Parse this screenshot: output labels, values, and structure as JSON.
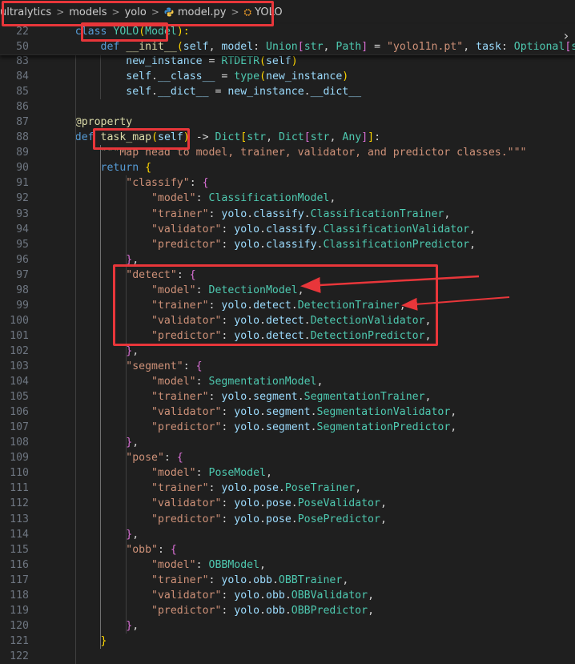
{
  "breadcrumb": {
    "items": [
      "ultralytics",
      "models",
      "yolo",
      "model.py",
      "YOLO"
    ],
    "separator": ">",
    "icons": [
      "python-file-icon",
      "class-symbol-icon"
    ]
  },
  "sticky_lines": [
    {
      "n": "22",
      "tokens": [
        [
          "    ",
          ""
        ],
        [
          "class",
          "kw"
        ],
        [
          " ",
          ""
        ],
        [
          "YOLO",
          "cls"
        ],
        [
          "(",
          "br1"
        ],
        [
          "Model",
          "cls"
        ],
        [
          "):",
          "br1"
        ]
      ]
    },
    {
      "n": "50",
      "tokens": [
        [
          "        ",
          ""
        ],
        [
          "def",
          "kw"
        ],
        [
          " ",
          ""
        ],
        [
          "__init__",
          "fn"
        ],
        [
          "(",
          "br1"
        ],
        [
          "self",
          "sf"
        ],
        [
          ", ",
          ""
        ],
        [
          "model",
          "var"
        ],
        [
          ": ",
          ""
        ],
        [
          "Union",
          "cls"
        ],
        [
          "[",
          "br2"
        ],
        [
          "str",
          "cls"
        ],
        [
          ", ",
          ""
        ],
        [
          "Path",
          "cls"
        ],
        [
          "]",
          "br2"
        ],
        [
          " = ",
          ""
        ],
        [
          "\"yolo11n.pt\"",
          "str"
        ],
        [
          ", ",
          ""
        ],
        [
          "task",
          "var"
        ],
        [
          ": ",
          ""
        ],
        [
          "Optional",
          "cls"
        ],
        [
          "[",
          "br2"
        ],
        [
          "str",
          "cls"
        ],
        [
          "]",
          "br2"
        ]
      ]
    }
  ],
  "lines": [
    {
      "n": "83",
      "tokens": [
        [
          "            new_instance",
          "var"
        ],
        [
          " = ",
          ""
        ],
        [
          "RTDETR",
          "cls"
        ],
        [
          "(",
          "br1"
        ],
        [
          "self",
          "sf"
        ],
        [
          ")",
          "br1"
        ]
      ],
      "indent": 3
    },
    {
      "n": "84",
      "tokens": [
        [
          "            self",
          "sf"
        ],
        [
          ".",
          ""
        ],
        [
          "__class__",
          "var"
        ],
        [
          " = ",
          ""
        ],
        [
          "type",
          "cls"
        ],
        [
          "(",
          "br1"
        ],
        [
          "new_instance",
          "var"
        ],
        [
          ")",
          "br1"
        ]
      ],
      "indent": 3
    },
    {
      "n": "85",
      "tokens": [
        [
          "            self",
          "sf"
        ],
        [
          ".",
          ""
        ],
        [
          "__dict__",
          "var"
        ],
        [
          " = ",
          ""
        ],
        [
          "new_instance",
          "var"
        ],
        [
          ".",
          ""
        ],
        [
          "__dict__",
          "var"
        ]
      ],
      "indent": 3
    },
    {
      "n": "86",
      "tokens": [],
      "indent": 0
    },
    {
      "n": "87",
      "tokens": [
        [
          "    @",
          "dec"
        ],
        [
          "property",
          "dec"
        ]
      ],
      "indent": 1
    },
    {
      "n": "88",
      "tokens": [
        [
          "    ",
          ""
        ],
        [
          "def",
          "kw"
        ],
        [
          " ",
          ""
        ],
        [
          "task_map",
          "fn"
        ],
        [
          "(",
          "br1"
        ],
        [
          "self",
          "sf"
        ],
        [
          ")",
          "br1"
        ],
        [
          " -> ",
          ""
        ],
        [
          "Dict",
          "cls"
        ],
        [
          "[",
          "br1"
        ],
        [
          "str",
          "cls"
        ],
        [
          ", ",
          ""
        ],
        [
          "Dict",
          "cls"
        ],
        [
          "[",
          "br2"
        ],
        [
          "str",
          "cls"
        ],
        [
          ", ",
          ""
        ],
        [
          "Any",
          "cls"
        ],
        [
          "]",
          "br2"
        ],
        [
          "]",
          "br1"
        ],
        [
          ":",
          ""
        ]
      ],
      "indent": 1
    },
    {
      "n": "89",
      "tokens": [
        [
          "        \"\"\"Map head to model, trainer, validator, and predictor classes.\"\"\"",
          "str"
        ]
      ],
      "indent": 2
    },
    {
      "n": "90",
      "tokens": [
        [
          "        ",
          ""
        ],
        [
          "return",
          "kw"
        ],
        [
          " ",
          ""
        ],
        [
          "{",
          "br1"
        ]
      ],
      "indent": 2
    },
    {
      "n": "91",
      "tokens": [
        [
          "            ",
          ""
        ],
        [
          "\"classify\"",
          "str"
        ],
        [
          ": ",
          ""
        ],
        [
          "{",
          "br2"
        ]
      ],
      "indent": 3
    },
    {
      "n": "92",
      "tokens": [
        [
          "                ",
          ""
        ],
        [
          "\"model\"",
          "str"
        ],
        [
          ": ",
          ""
        ],
        [
          "ClassificationModel",
          "cls"
        ],
        [
          ",",
          ""
        ]
      ],
      "indent": 4
    },
    {
      "n": "93",
      "tokens": [
        [
          "                ",
          ""
        ],
        [
          "\"trainer\"",
          "str"
        ],
        [
          ": ",
          ""
        ],
        [
          "yolo",
          "var"
        ],
        [
          ".",
          ""
        ],
        [
          "classify",
          "var"
        ],
        [
          ".",
          ""
        ],
        [
          "ClassificationTrainer",
          "cls"
        ],
        [
          ",",
          ""
        ]
      ],
      "indent": 4
    },
    {
      "n": "94",
      "tokens": [
        [
          "                ",
          ""
        ],
        [
          "\"validator\"",
          "str"
        ],
        [
          ": ",
          ""
        ],
        [
          "yolo",
          "var"
        ],
        [
          ".",
          ""
        ],
        [
          "classify",
          "var"
        ],
        [
          ".",
          ""
        ],
        [
          "ClassificationValidator",
          "cls"
        ],
        [
          ",",
          ""
        ]
      ],
      "indent": 4
    },
    {
      "n": "95",
      "tokens": [
        [
          "                ",
          ""
        ],
        [
          "\"predictor\"",
          "str"
        ],
        [
          ": ",
          ""
        ],
        [
          "yolo",
          "var"
        ],
        [
          ".",
          ""
        ],
        [
          "classify",
          "var"
        ],
        [
          ".",
          ""
        ],
        [
          "ClassificationPredictor",
          "cls"
        ],
        [
          ",",
          ""
        ]
      ],
      "indent": 4
    },
    {
      "n": "96",
      "tokens": [
        [
          "            ",
          ""
        ],
        [
          "}",
          "br2"
        ],
        [
          ",",
          ""
        ]
      ],
      "indent": 3
    },
    {
      "n": "97",
      "tokens": [
        [
          "            ",
          ""
        ],
        [
          "\"detect\"",
          "str"
        ],
        [
          ": ",
          ""
        ],
        [
          "{",
          "br2"
        ]
      ],
      "indent": 3
    },
    {
      "n": "98",
      "tokens": [
        [
          "                ",
          ""
        ],
        [
          "\"model\"",
          "str"
        ],
        [
          ": ",
          ""
        ],
        [
          "DetectionModel",
          "cls"
        ],
        [
          ",",
          ""
        ]
      ],
      "indent": 4
    },
    {
      "n": "99",
      "tokens": [
        [
          "                ",
          ""
        ],
        [
          "\"trainer\"",
          "str"
        ],
        [
          ": ",
          ""
        ],
        [
          "yolo",
          "var"
        ],
        [
          ".",
          ""
        ],
        [
          "detect",
          "var"
        ],
        [
          ".",
          ""
        ],
        [
          "DetectionTrainer",
          "cls"
        ],
        [
          ",",
          ""
        ]
      ],
      "indent": 4
    },
    {
      "n": "100",
      "tokens": [
        [
          "                ",
          ""
        ],
        [
          "\"validator\"",
          "str"
        ],
        [
          ": ",
          ""
        ],
        [
          "yolo",
          "var"
        ],
        [
          ".",
          ""
        ],
        [
          "detect",
          "var"
        ],
        [
          ".",
          ""
        ],
        [
          "DetectionValidator",
          "cls"
        ],
        [
          ",",
          ""
        ]
      ],
      "indent": 4
    },
    {
      "n": "101",
      "tokens": [
        [
          "                ",
          ""
        ],
        [
          "\"predictor\"",
          "str"
        ],
        [
          ": ",
          ""
        ],
        [
          "yolo",
          "var"
        ],
        [
          ".",
          ""
        ],
        [
          "detect",
          "var"
        ],
        [
          ".",
          ""
        ],
        [
          "DetectionPredictor",
          "cls"
        ],
        [
          ",",
          ""
        ]
      ],
      "indent": 4
    },
    {
      "n": "102",
      "tokens": [
        [
          "            ",
          ""
        ],
        [
          "}",
          "br2"
        ],
        [
          ",",
          ""
        ]
      ],
      "indent": 3
    },
    {
      "n": "103",
      "tokens": [
        [
          "            ",
          ""
        ],
        [
          "\"segment\"",
          "str"
        ],
        [
          ": ",
          ""
        ],
        [
          "{",
          "br2"
        ]
      ],
      "indent": 3
    },
    {
      "n": "104",
      "tokens": [
        [
          "                ",
          ""
        ],
        [
          "\"model\"",
          "str"
        ],
        [
          ": ",
          ""
        ],
        [
          "SegmentationModel",
          "cls"
        ],
        [
          ",",
          ""
        ]
      ],
      "indent": 4
    },
    {
      "n": "105",
      "tokens": [
        [
          "                ",
          ""
        ],
        [
          "\"trainer\"",
          "str"
        ],
        [
          ": ",
          ""
        ],
        [
          "yolo",
          "var"
        ],
        [
          ".",
          ""
        ],
        [
          "segment",
          "var"
        ],
        [
          ".",
          ""
        ],
        [
          "SegmentationTrainer",
          "cls"
        ],
        [
          ",",
          ""
        ]
      ],
      "indent": 4
    },
    {
      "n": "106",
      "tokens": [
        [
          "                ",
          ""
        ],
        [
          "\"validator\"",
          "str"
        ],
        [
          ": ",
          ""
        ],
        [
          "yolo",
          "var"
        ],
        [
          ".",
          ""
        ],
        [
          "segment",
          "var"
        ],
        [
          ".",
          ""
        ],
        [
          "SegmentationValidator",
          "cls"
        ],
        [
          ",",
          ""
        ]
      ],
      "indent": 4
    },
    {
      "n": "107",
      "tokens": [
        [
          "                ",
          ""
        ],
        [
          "\"predictor\"",
          "str"
        ],
        [
          ": ",
          ""
        ],
        [
          "yolo",
          "var"
        ],
        [
          ".",
          ""
        ],
        [
          "segment",
          "var"
        ],
        [
          ".",
          ""
        ],
        [
          "SegmentationPredictor",
          "cls"
        ],
        [
          ",",
          ""
        ]
      ],
      "indent": 4
    },
    {
      "n": "108",
      "tokens": [
        [
          "            ",
          ""
        ],
        [
          "}",
          "br2"
        ],
        [
          ",",
          ""
        ]
      ],
      "indent": 3
    },
    {
      "n": "109",
      "tokens": [
        [
          "            ",
          ""
        ],
        [
          "\"pose\"",
          "str"
        ],
        [
          ": ",
          ""
        ],
        [
          "{",
          "br2"
        ]
      ],
      "indent": 3
    },
    {
      "n": "110",
      "tokens": [
        [
          "                ",
          ""
        ],
        [
          "\"model\"",
          "str"
        ],
        [
          ": ",
          ""
        ],
        [
          "PoseModel",
          "cls"
        ],
        [
          ",",
          ""
        ]
      ],
      "indent": 4
    },
    {
      "n": "111",
      "tokens": [
        [
          "                ",
          ""
        ],
        [
          "\"trainer\"",
          "str"
        ],
        [
          ": ",
          ""
        ],
        [
          "yolo",
          "var"
        ],
        [
          ".",
          ""
        ],
        [
          "pose",
          "var"
        ],
        [
          ".",
          ""
        ],
        [
          "PoseTrainer",
          "cls"
        ],
        [
          ",",
          ""
        ]
      ],
      "indent": 4
    },
    {
      "n": "112",
      "tokens": [
        [
          "                ",
          ""
        ],
        [
          "\"validator\"",
          "str"
        ],
        [
          ": ",
          ""
        ],
        [
          "yolo",
          "var"
        ],
        [
          ".",
          ""
        ],
        [
          "pose",
          "var"
        ],
        [
          ".",
          ""
        ],
        [
          "PoseValidator",
          "cls"
        ],
        [
          ",",
          ""
        ]
      ],
      "indent": 4
    },
    {
      "n": "113",
      "tokens": [
        [
          "                ",
          ""
        ],
        [
          "\"predictor\"",
          "str"
        ],
        [
          ": ",
          ""
        ],
        [
          "yolo",
          "var"
        ],
        [
          ".",
          ""
        ],
        [
          "pose",
          "var"
        ],
        [
          ".",
          ""
        ],
        [
          "PosePredictor",
          "cls"
        ],
        [
          ",",
          ""
        ]
      ],
      "indent": 4
    },
    {
      "n": "114",
      "tokens": [
        [
          "            ",
          ""
        ],
        [
          "}",
          "br2"
        ],
        [
          ",",
          ""
        ]
      ],
      "indent": 3
    },
    {
      "n": "115",
      "tokens": [
        [
          "            ",
          ""
        ],
        [
          "\"obb\"",
          "str"
        ],
        [
          ": ",
          ""
        ],
        [
          "{",
          "br2"
        ]
      ],
      "indent": 3
    },
    {
      "n": "116",
      "tokens": [
        [
          "                ",
          ""
        ],
        [
          "\"model\"",
          "str"
        ],
        [
          ": ",
          ""
        ],
        [
          "OBBModel",
          "cls"
        ],
        [
          ",",
          ""
        ]
      ],
      "indent": 4
    },
    {
      "n": "117",
      "tokens": [
        [
          "                ",
          ""
        ],
        [
          "\"trainer\"",
          "str"
        ],
        [
          ": ",
          ""
        ],
        [
          "yolo",
          "var"
        ],
        [
          ".",
          ""
        ],
        [
          "obb",
          "var"
        ],
        [
          ".",
          ""
        ],
        [
          "OBBTrainer",
          "cls"
        ],
        [
          ",",
          ""
        ]
      ],
      "indent": 4
    },
    {
      "n": "118",
      "tokens": [
        [
          "                ",
          ""
        ],
        [
          "\"validator\"",
          "str"
        ],
        [
          ": ",
          ""
        ],
        [
          "yolo",
          "var"
        ],
        [
          ".",
          ""
        ],
        [
          "obb",
          "var"
        ],
        [
          ".",
          ""
        ],
        [
          "OBBValidator",
          "cls"
        ],
        [
          ",",
          ""
        ]
      ],
      "indent": 4
    },
    {
      "n": "119",
      "tokens": [
        [
          "                ",
          ""
        ],
        [
          "\"predictor\"",
          "str"
        ],
        [
          ": ",
          ""
        ],
        [
          "yolo",
          "var"
        ],
        [
          ".",
          ""
        ],
        [
          "obb",
          "var"
        ],
        [
          ".",
          ""
        ],
        [
          "OBBPredictor",
          "cls"
        ],
        [
          ",",
          ""
        ]
      ],
      "indent": 4
    },
    {
      "n": "120",
      "tokens": [
        [
          "            ",
          ""
        ],
        [
          "}",
          "br2"
        ],
        [
          ",",
          ""
        ]
      ],
      "indent": 3
    },
    {
      "n": "121",
      "tokens": [
        [
          "        ",
          ""
        ],
        [
          "}",
          "br1"
        ]
      ],
      "indent": 2
    },
    {
      "n": "122",
      "tokens": [],
      "indent": 0
    }
  ],
  "colors": {
    "annotation": "#e8363a",
    "background": "#1f1f1f",
    "line_number": "#6e7681"
  }
}
